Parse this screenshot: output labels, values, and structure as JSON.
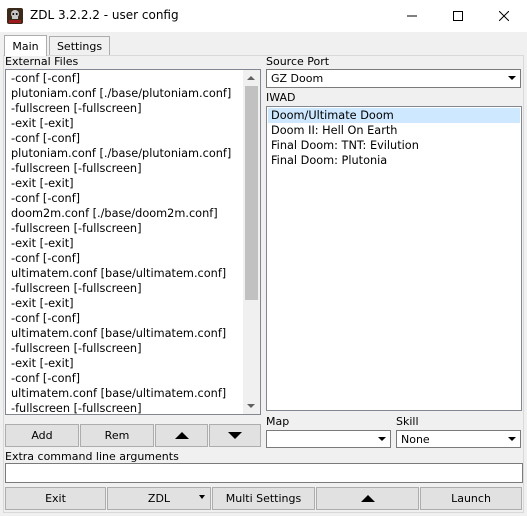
{
  "window": {
    "title": "ZDL 3.2.2.2 - user config",
    "icon": "zdl-app-icon",
    "controls": {
      "minimize": "minimize-icon",
      "maximize": "maximize-icon",
      "close": "close-icon"
    }
  },
  "tabs": [
    {
      "label": "Main",
      "selected": true
    },
    {
      "label": "Settings",
      "selected": false
    }
  ],
  "external_files": {
    "label": "External Files",
    "items": [
      "-conf [-conf]",
      "plutoniam.conf [./base/plutoniam.conf]",
      "-fullscreen [-fullscreen]",
      "-exit [-exit]",
      "-conf [-conf]",
      "plutoniam.conf [./base/plutoniam.conf]",
      "-fullscreen [-fullscreen]",
      "-exit [-exit]",
      "-conf [-conf]",
      "doom2m.conf [./base/doom2m.conf]",
      "-fullscreen [-fullscreen]",
      "-exit [-exit]",
      "-conf [-conf]",
      "ultimatem.conf [base/ultimatem.conf]",
      "-fullscreen [-fullscreen]",
      "-exit [-exit]",
      "-conf [-conf]",
      "ultimatem.conf [base/ultimatem.conf]",
      "-fullscreen [-fullscreen]",
      "-exit [-exit]",
      "-conf [-conf]",
      "ultimatem.conf [base/ultimatem.conf]",
      "-fullscreen [-fullscreen]"
    ]
  },
  "file_buttons": {
    "add": "Add",
    "remove": "Rem"
  },
  "source_port": {
    "label": "Source Port",
    "value": "GZ Doom"
  },
  "iwad": {
    "label": "IWAD",
    "items": [
      "Doom/Ultimate Doom",
      "Doom II: Hell On Earth",
      "Final Doom: TNT: Evilution",
      "Final Doom: Plutonia"
    ],
    "selected_index": 0
  },
  "map": {
    "label": "Map",
    "value": ""
  },
  "skill": {
    "label": "Skill",
    "value": "None"
  },
  "extra_args": {
    "label": "Extra command line arguments",
    "value": ""
  },
  "bottom_buttons": {
    "exit": "Exit",
    "zdl": "ZDL",
    "multi": "Multi Settings",
    "launch": "Launch"
  },
  "colors": {
    "selection": "#cde8ff",
    "button_face": "#e1e1e1",
    "window_bg": "#f0f0f0"
  }
}
